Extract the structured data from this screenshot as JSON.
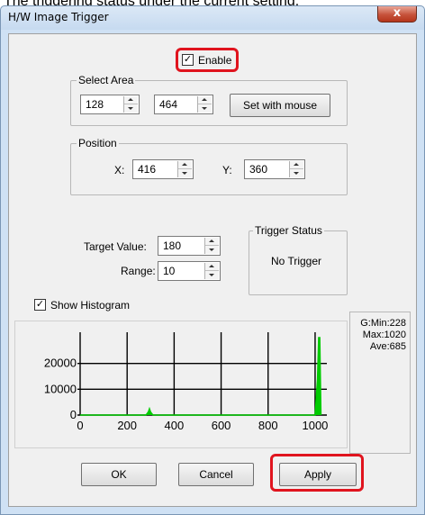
{
  "caption": "The triggering status under the current setting.",
  "window": {
    "title": "H/W Image Trigger",
    "close_glyph": "x"
  },
  "enable": {
    "label": "Enable",
    "checked": true
  },
  "select_area": {
    "title": "Select Area",
    "start": "128",
    "end": "464",
    "set_with_mouse_label": "Set with mouse"
  },
  "position": {
    "title": "Position",
    "x_label": "X:",
    "x_value": "416",
    "y_label": "Y:",
    "y_value": "360"
  },
  "target": {
    "label": "Target Value:",
    "value": "180"
  },
  "range": {
    "label": "Range:",
    "value": "10"
  },
  "trigger_status": {
    "title": "Trigger Status",
    "value": "No Trigger"
  },
  "show_histogram": {
    "label": "Show Histogram",
    "checked": true
  },
  "stats": {
    "min": "G:Min:228",
    "max": "Max:1020",
    "ave": "Ave:685"
  },
  "buttons": {
    "ok": "OK",
    "cancel": "Cancel",
    "apply": "Apply"
  },
  "check_glyph": "✓",
  "chart_data": {
    "type": "area",
    "title": "",
    "xlabel": "",
    "ylabel": "",
    "xlim": [
      0,
      1050
    ],
    "ylim": [
      0,
      30000
    ],
    "x_ticks": [
      0,
      200,
      400,
      600,
      800,
      1000
    ],
    "y_ticks": [
      0,
      10000,
      20000
    ],
    "grid": true,
    "series": [
      {
        "color": "#00cc00",
        "points": [
          [
            0,
            0
          ],
          [
            280,
            0
          ],
          [
            290,
            1200
          ],
          [
            295,
            2500
          ],
          [
            300,
            1200
          ],
          [
            310,
            0
          ],
          [
            1000,
            0
          ],
          [
            1010,
            14000
          ],
          [
            1015,
            30000
          ],
          [
            1020,
            30000
          ],
          [
            1025,
            0
          ]
        ]
      }
    ]
  },
  "colors": {
    "highlight": "#e0141e",
    "series": "#00cc00"
  }
}
